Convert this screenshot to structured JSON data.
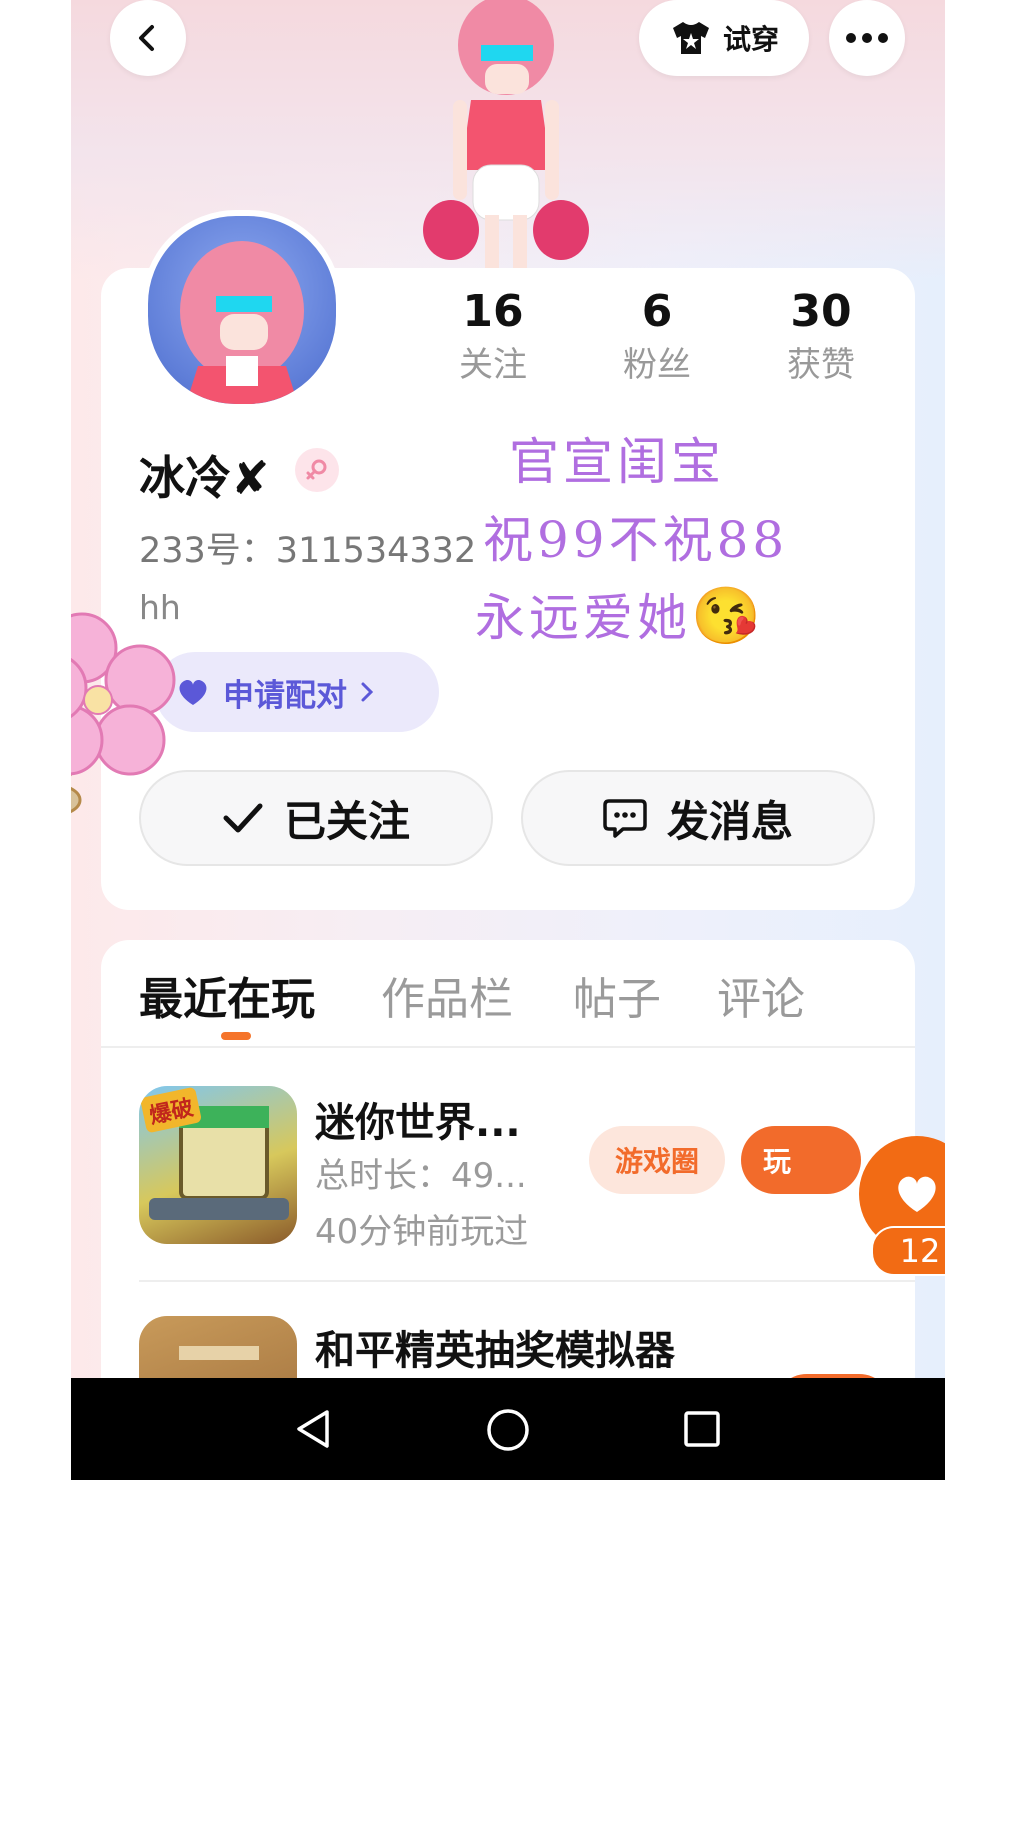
{
  "header": {
    "try_on_label": "试穿"
  },
  "profile": {
    "following_count": "16",
    "following_label": "关注",
    "fans_count": "6",
    "fans_label": "粉丝",
    "likes_count": "30",
    "likes_label": "获赞",
    "name": "冰冷✘",
    "uid": "233号：311534332",
    "bio": "hh",
    "pair_label": "申请配对",
    "followed_label": "已关注",
    "message_label": "发消息"
  },
  "overlay_text": {
    "line1": "官宣闺宝",
    "line2": "祝99不祝88",
    "line3": "永远爱她",
    "emoji": "😘"
  },
  "tabs": [
    {
      "label": "最近在玩",
      "active": true
    },
    {
      "label": "作品栏",
      "active": false
    },
    {
      "label": "帖子",
      "active": false
    },
    {
      "label": "评论",
      "active": false
    }
  ],
  "games": [
    {
      "title": "迷你世界...",
      "duration": "总时长：49...",
      "last_played": "40分钟前玩过",
      "circle_label": "游戏圈",
      "play_label": "玩",
      "icon_text": "爆破"
    },
    {
      "title": "和平精英抽奖模拟器"
    }
  ],
  "like_button": {
    "count": "12"
  },
  "colors": {
    "accent": "#f26b2b",
    "pair": "#5b58d8",
    "handwriting": "#b06ee0"
  },
  "icons": [
    "back-icon",
    "shirt-icon",
    "more-icon",
    "female-icon",
    "heart-icon",
    "check-icon",
    "chat-icon",
    "chevron-right-icon",
    "flower-sticker",
    "nav-back-icon",
    "nav-home-icon",
    "nav-recents-icon"
  ]
}
